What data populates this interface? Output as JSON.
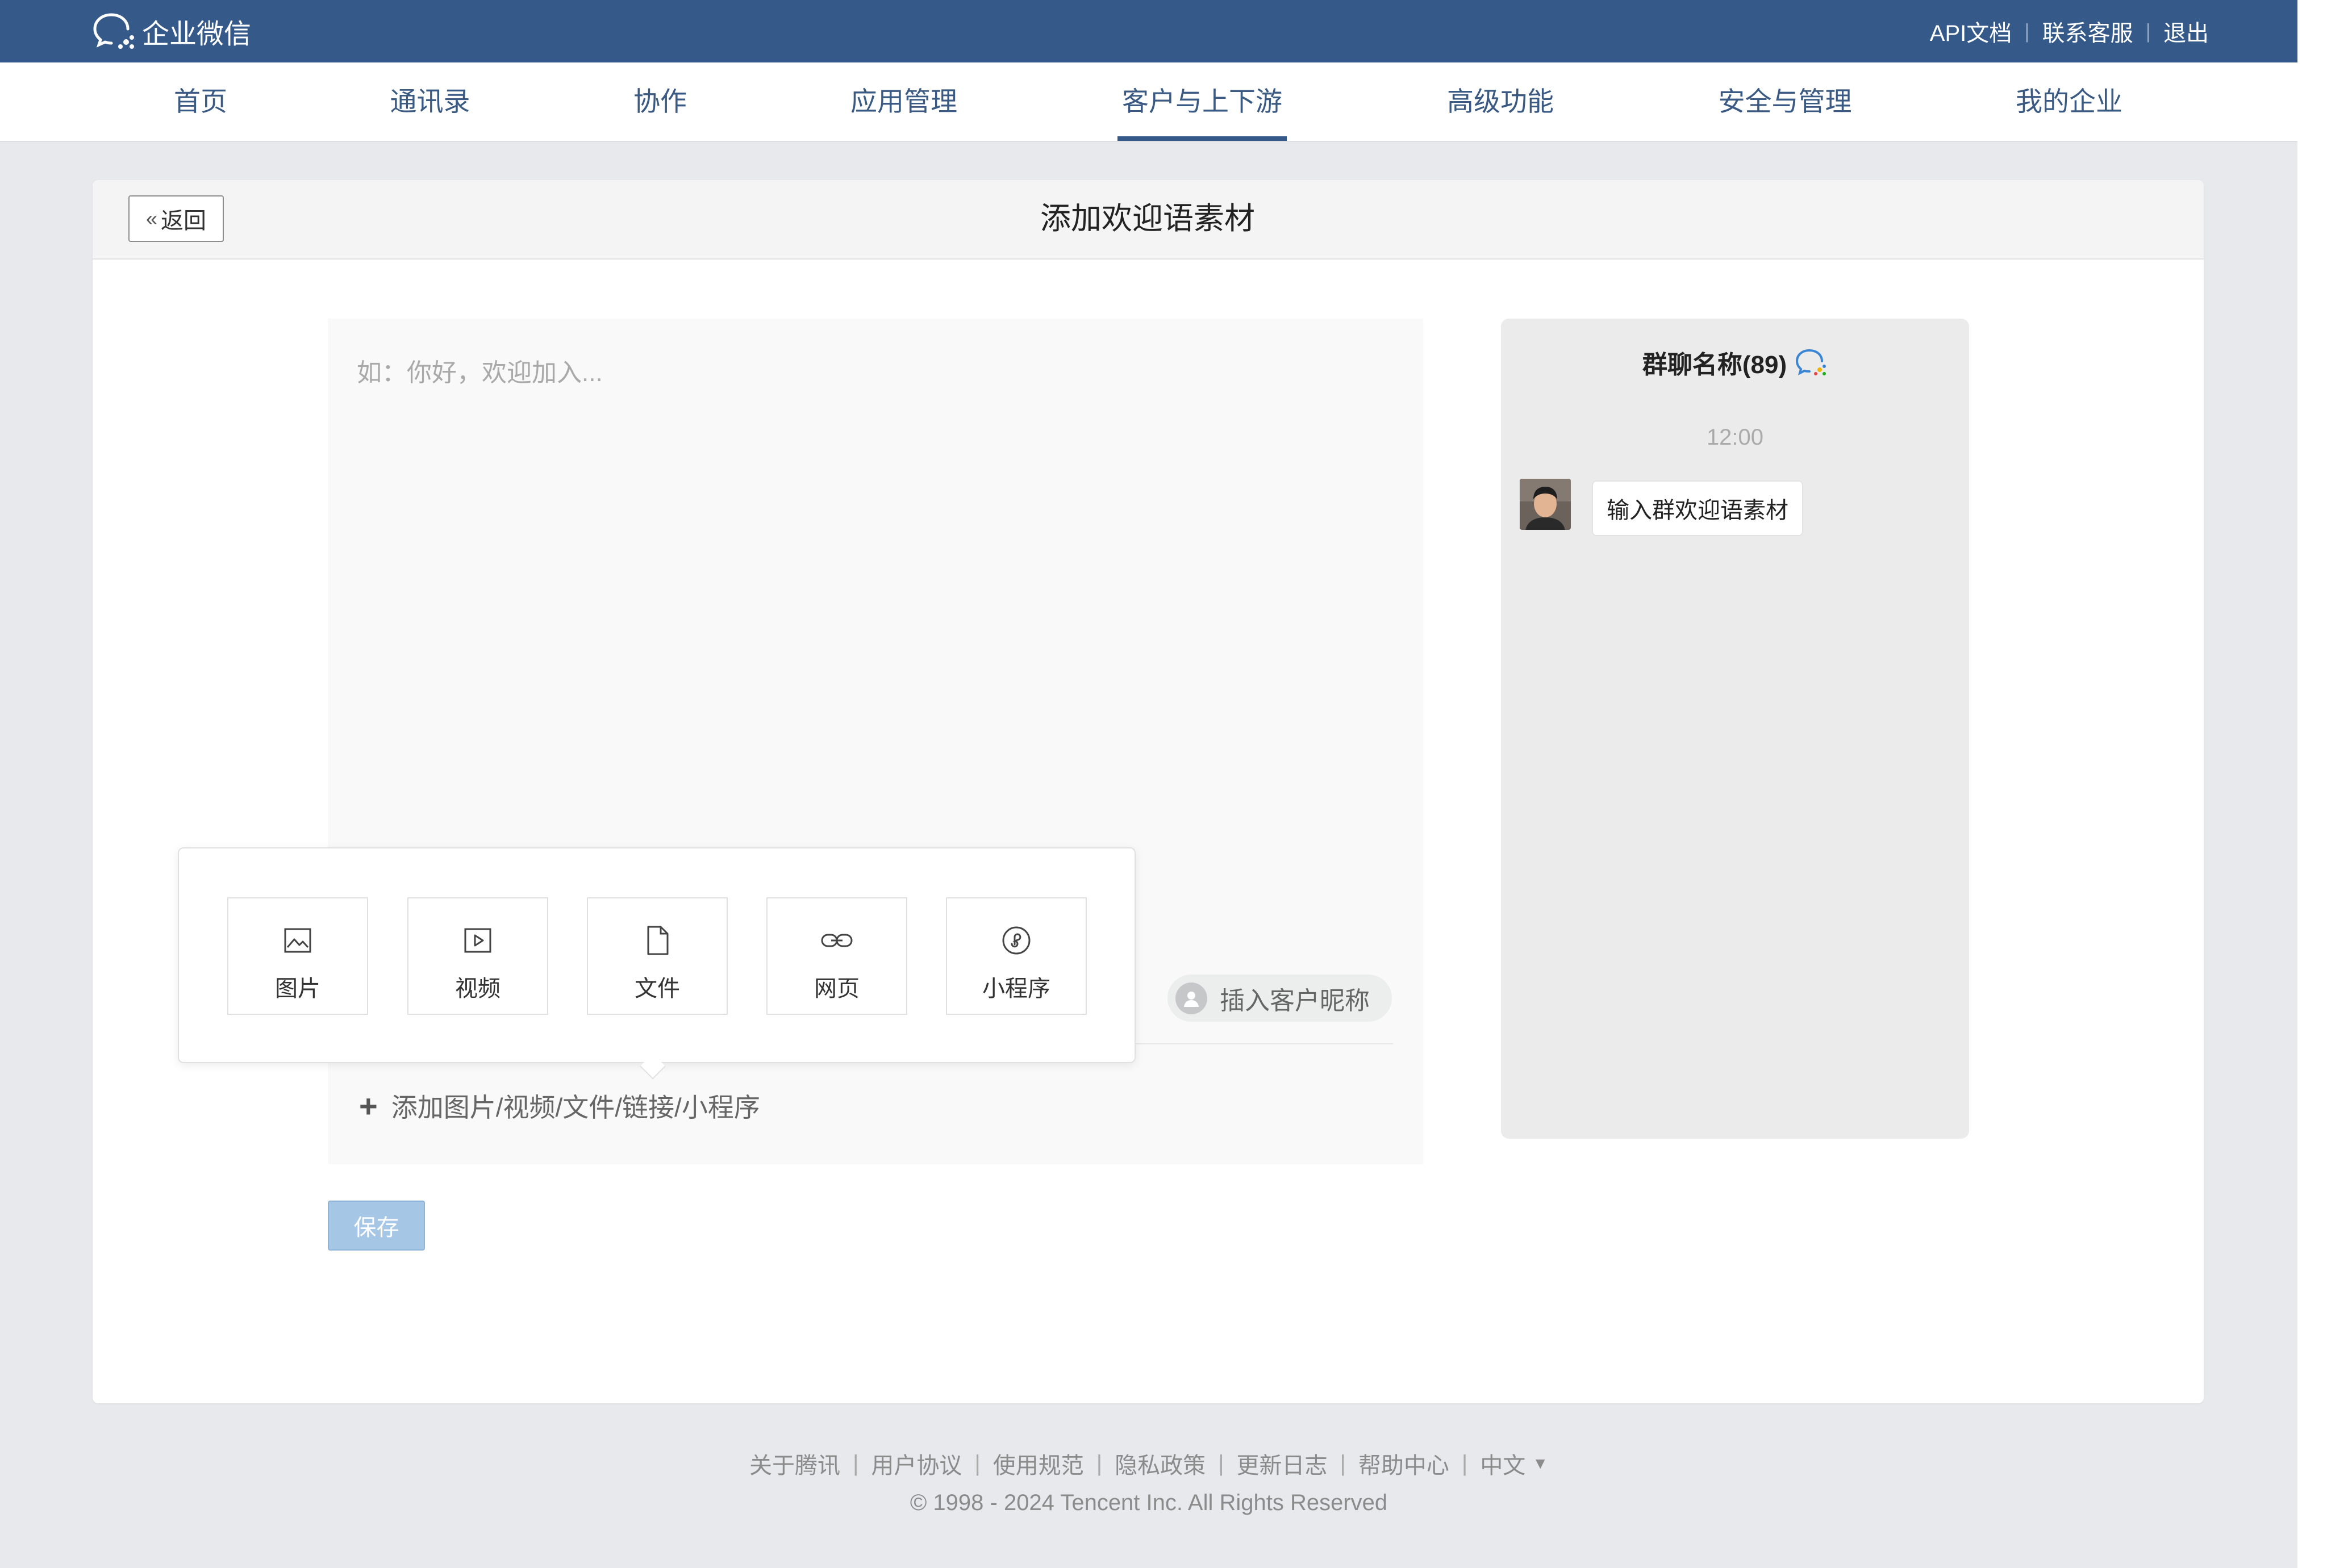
{
  "app": {
    "logo_text": "企业微信"
  },
  "topbar": {
    "links": [
      "API文档",
      "联系客服",
      "退出"
    ]
  },
  "nav": {
    "items": [
      "首页",
      "通讯录",
      "协作",
      "应用管理",
      "客户与上下游",
      "高级功能",
      "安全与管理",
      "我的企业"
    ],
    "active_index": 4
  },
  "header": {
    "back_label": "返回",
    "title": "添加欢迎语素材"
  },
  "editor": {
    "placeholder": "如：你好，欢迎加入...",
    "insert_nickname_label": "插入客户昵称",
    "add_material_label": "添加图片/视频/文件/链接/小程序"
  },
  "popover": {
    "tiles": [
      {
        "label": "图片",
        "icon": "image-icon"
      },
      {
        "label": "视频",
        "icon": "video-icon"
      },
      {
        "label": "文件",
        "icon": "file-icon"
      },
      {
        "label": "网页",
        "icon": "link-icon"
      },
      {
        "label": "小程序",
        "icon": "miniprogram-icon"
      }
    ]
  },
  "save": {
    "label": "保存"
  },
  "preview": {
    "group_name": "群聊名称(89)",
    "time": "12:00",
    "bubble_text": "输入群欢迎语素材"
  },
  "footer": {
    "links": [
      "关于腾讯",
      "用户协议",
      "使用规范",
      "隐私政策",
      "更新日志",
      "帮助中心",
      "中文"
    ],
    "copyright": "© 1998 - 2024 Tencent Inc. All Rights Reserved"
  },
  "colors": {
    "topbar": "#355a8a",
    "nav_text": "#3a5a83",
    "save_button": "#a6c6e6",
    "page_bg": "#e8e9ec"
  }
}
